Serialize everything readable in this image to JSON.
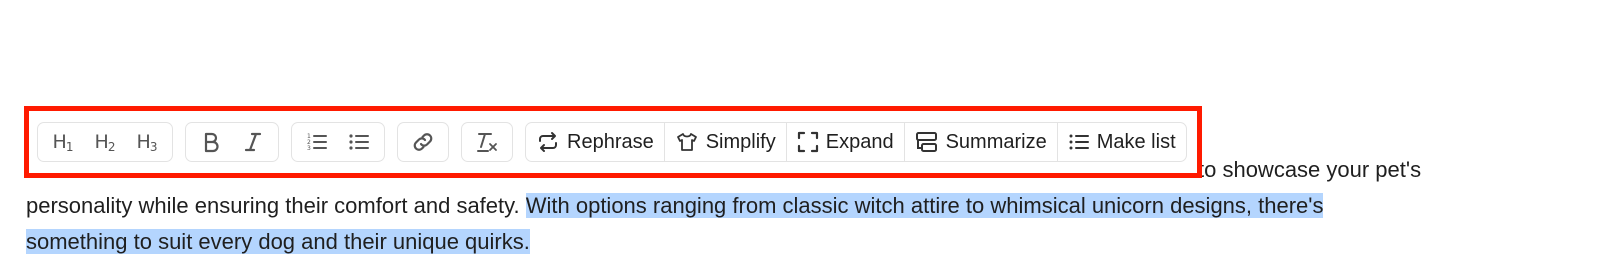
{
  "toolbar": {
    "heading_buttons": [
      {
        "label": "H",
        "level": "1"
      },
      {
        "label": "H",
        "level": "2"
      },
      {
        "label": "H",
        "level": "3"
      }
    ],
    "ai_actions": {
      "rephrase": "Rephrase",
      "simplify": "Simplify",
      "expand": "Expand",
      "summarize": "Summarize",
      "make_list": "Make list"
    },
    "highlight_color": "#ff1a00"
  },
  "editor": {
    "line1_tail": "to showcase your pet's",
    "line2_plain": "personality while ensuring their comfort and safety. ",
    "line2_selected": "With options ranging from classic witch attire to whimsical unicorn designs, there's",
    "line3_selected": "something to suit every dog and their unique quirks.",
    "selection_color": "#b4d5fe"
  }
}
